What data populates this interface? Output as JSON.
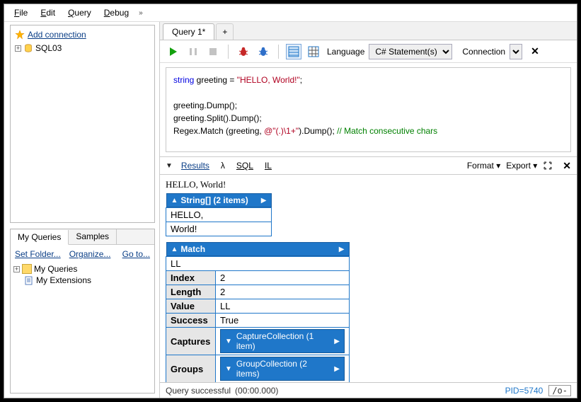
{
  "menu": {
    "file": "File",
    "edit": "Edit",
    "query": "Query",
    "debug": "Debug"
  },
  "left": {
    "addConnection": "Add connection",
    "connectionName": "SQL03",
    "myQueriesTab": "My Queries",
    "samplesTab": "Samples",
    "setFolder": "Set Folder...",
    "organize": "Organize...",
    "goTo": "Go to...",
    "folderMyQueries": "My Queries",
    "fileMyExtensions": "My Extensions"
  },
  "tabs": {
    "query1": "Query 1*",
    "plus": "+"
  },
  "toolbar": {
    "languageLabel": "Language",
    "languageValue": "C# Statement(s)",
    "connectionLabel": "Connection"
  },
  "code": {
    "l1a": "string",
    "l1b": " greeting = ",
    "l1c": "\"HELLO, World!\"",
    "l1d": ";",
    "l3": "greeting.Dump();",
    "l4": "greeting.Split().Dump();",
    "l5a": "Regex.Match (greeting, ",
    "l5b": "@\"(.)\\1+\"",
    "l5c": ").Dump();   ",
    "l5d": "// Match consecutive chars"
  },
  "resultsBar": {
    "results": "Results",
    "lambda": "λ",
    "sql": "SQL",
    "il": "IL",
    "format": "Format",
    "export": "Export"
  },
  "results": {
    "greeting": "HELLO, World!",
    "stringArrHeader": "String[] (2 items)",
    "items": [
      "HELLO,",
      "World!"
    ],
    "matchHeader": "Match",
    "matchPreview": "LL",
    "rows": {
      "IndexK": "Index",
      "IndexV": "2",
      "LengthK": "Length",
      "LengthV": "2",
      "ValueK": "Value",
      "ValueV": "LL",
      "SuccessK": "Success",
      "SuccessV": "True",
      "CapturesK": "Captures",
      "CapturesV": "CaptureCollection (1 item)",
      "GroupsK": "Groups",
      "GroupsV": "GroupCollection (2 items)"
    }
  },
  "status": {
    "text": "Query successful",
    "time": "(00:00.000)",
    "pid": "PID=5740",
    "mode": "/o-"
  }
}
